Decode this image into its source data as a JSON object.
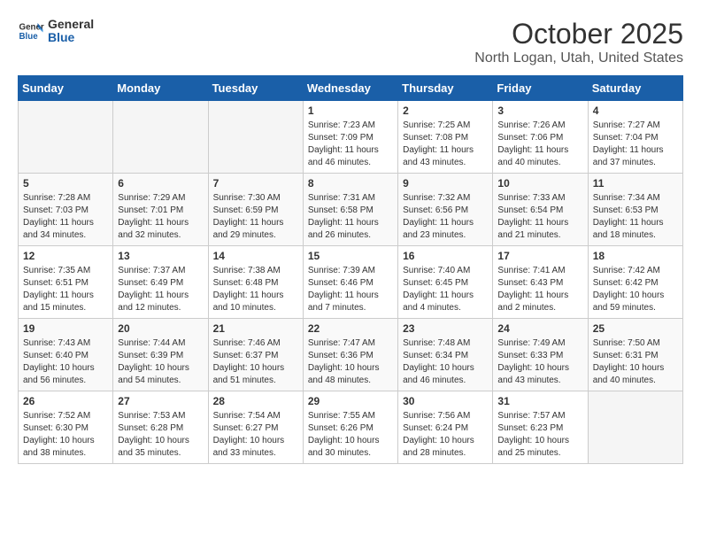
{
  "logo": {
    "line1": "General",
    "line2": "Blue"
  },
  "title": "October 2025",
  "location": "North Logan, Utah, United States",
  "weekdays": [
    "Sunday",
    "Monday",
    "Tuesday",
    "Wednesday",
    "Thursday",
    "Friday",
    "Saturday"
  ],
  "weeks": [
    [
      {
        "day": "",
        "info": ""
      },
      {
        "day": "",
        "info": ""
      },
      {
        "day": "",
        "info": ""
      },
      {
        "day": "1",
        "info": "Sunrise: 7:23 AM\nSunset: 7:09 PM\nDaylight: 11 hours and 46 minutes."
      },
      {
        "day": "2",
        "info": "Sunrise: 7:25 AM\nSunset: 7:08 PM\nDaylight: 11 hours and 43 minutes."
      },
      {
        "day": "3",
        "info": "Sunrise: 7:26 AM\nSunset: 7:06 PM\nDaylight: 11 hours and 40 minutes."
      },
      {
        "day": "4",
        "info": "Sunrise: 7:27 AM\nSunset: 7:04 PM\nDaylight: 11 hours and 37 minutes."
      }
    ],
    [
      {
        "day": "5",
        "info": "Sunrise: 7:28 AM\nSunset: 7:03 PM\nDaylight: 11 hours and 34 minutes."
      },
      {
        "day": "6",
        "info": "Sunrise: 7:29 AM\nSunset: 7:01 PM\nDaylight: 11 hours and 32 minutes."
      },
      {
        "day": "7",
        "info": "Sunrise: 7:30 AM\nSunset: 6:59 PM\nDaylight: 11 hours and 29 minutes."
      },
      {
        "day": "8",
        "info": "Sunrise: 7:31 AM\nSunset: 6:58 PM\nDaylight: 11 hours and 26 minutes."
      },
      {
        "day": "9",
        "info": "Sunrise: 7:32 AM\nSunset: 6:56 PM\nDaylight: 11 hours and 23 minutes."
      },
      {
        "day": "10",
        "info": "Sunrise: 7:33 AM\nSunset: 6:54 PM\nDaylight: 11 hours and 21 minutes."
      },
      {
        "day": "11",
        "info": "Sunrise: 7:34 AM\nSunset: 6:53 PM\nDaylight: 11 hours and 18 minutes."
      }
    ],
    [
      {
        "day": "12",
        "info": "Sunrise: 7:35 AM\nSunset: 6:51 PM\nDaylight: 11 hours and 15 minutes."
      },
      {
        "day": "13",
        "info": "Sunrise: 7:37 AM\nSunset: 6:49 PM\nDaylight: 11 hours and 12 minutes."
      },
      {
        "day": "14",
        "info": "Sunrise: 7:38 AM\nSunset: 6:48 PM\nDaylight: 11 hours and 10 minutes."
      },
      {
        "day": "15",
        "info": "Sunrise: 7:39 AM\nSunset: 6:46 PM\nDaylight: 11 hours and 7 minutes."
      },
      {
        "day": "16",
        "info": "Sunrise: 7:40 AM\nSunset: 6:45 PM\nDaylight: 11 hours and 4 minutes."
      },
      {
        "day": "17",
        "info": "Sunrise: 7:41 AM\nSunset: 6:43 PM\nDaylight: 11 hours and 2 minutes."
      },
      {
        "day": "18",
        "info": "Sunrise: 7:42 AM\nSunset: 6:42 PM\nDaylight: 10 hours and 59 minutes."
      }
    ],
    [
      {
        "day": "19",
        "info": "Sunrise: 7:43 AM\nSunset: 6:40 PM\nDaylight: 10 hours and 56 minutes."
      },
      {
        "day": "20",
        "info": "Sunrise: 7:44 AM\nSunset: 6:39 PM\nDaylight: 10 hours and 54 minutes."
      },
      {
        "day": "21",
        "info": "Sunrise: 7:46 AM\nSunset: 6:37 PM\nDaylight: 10 hours and 51 minutes."
      },
      {
        "day": "22",
        "info": "Sunrise: 7:47 AM\nSunset: 6:36 PM\nDaylight: 10 hours and 48 minutes."
      },
      {
        "day": "23",
        "info": "Sunrise: 7:48 AM\nSunset: 6:34 PM\nDaylight: 10 hours and 46 minutes."
      },
      {
        "day": "24",
        "info": "Sunrise: 7:49 AM\nSunset: 6:33 PM\nDaylight: 10 hours and 43 minutes."
      },
      {
        "day": "25",
        "info": "Sunrise: 7:50 AM\nSunset: 6:31 PM\nDaylight: 10 hours and 40 minutes."
      }
    ],
    [
      {
        "day": "26",
        "info": "Sunrise: 7:52 AM\nSunset: 6:30 PM\nDaylight: 10 hours and 38 minutes."
      },
      {
        "day": "27",
        "info": "Sunrise: 7:53 AM\nSunset: 6:28 PM\nDaylight: 10 hours and 35 minutes."
      },
      {
        "day": "28",
        "info": "Sunrise: 7:54 AM\nSunset: 6:27 PM\nDaylight: 10 hours and 33 minutes."
      },
      {
        "day": "29",
        "info": "Sunrise: 7:55 AM\nSunset: 6:26 PM\nDaylight: 10 hours and 30 minutes."
      },
      {
        "day": "30",
        "info": "Sunrise: 7:56 AM\nSunset: 6:24 PM\nDaylight: 10 hours and 28 minutes."
      },
      {
        "day": "31",
        "info": "Sunrise: 7:57 AM\nSunset: 6:23 PM\nDaylight: 10 hours and 25 minutes."
      },
      {
        "day": "",
        "info": ""
      }
    ]
  ]
}
